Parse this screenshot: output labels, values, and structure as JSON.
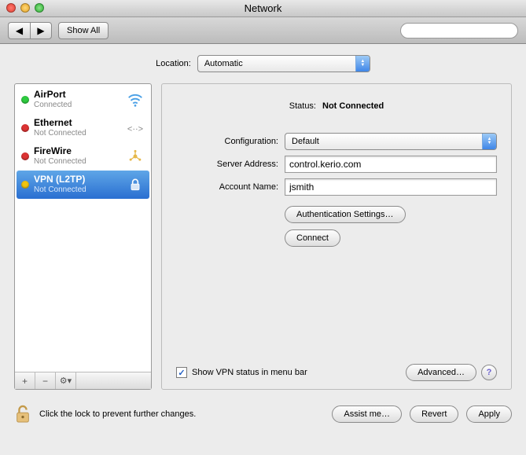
{
  "window": {
    "title": "Network"
  },
  "toolbar": {
    "show_all": "Show All",
    "search_placeholder": ""
  },
  "location": {
    "label": "Location:",
    "value": "Automatic"
  },
  "sidebar": {
    "items": [
      {
        "title": "AirPort",
        "subtitle": "Connected",
        "status": "green",
        "icon": "wifi-icon"
      },
      {
        "title": "Ethernet",
        "subtitle": "Not Connected",
        "status": "red",
        "icon": "ethernet-icon"
      },
      {
        "title": "FireWire",
        "subtitle": "Not Connected",
        "status": "red",
        "icon": "firewire-icon"
      },
      {
        "title": "VPN (L2TP)",
        "subtitle": "Not Connected",
        "status": "yellow",
        "icon": "vpn-lock-icon"
      }
    ],
    "selected_index": 3
  },
  "detail": {
    "status_label": "Status:",
    "status_value": "Not Connected",
    "config_label": "Configuration:",
    "config_value": "Default",
    "server_label": "Server Address:",
    "server_value": "control.kerio.com",
    "account_label": "Account Name:",
    "account_value": "jsmith",
    "auth_btn": "Authentication Settings…",
    "connect_btn": "Connect",
    "show_vpn_checkbox": "Show VPN status in menu bar",
    "show_vpn_checked": true,
    "advanced_btn": "Advanced…"
  },
  "footer": {
    "lock_text": "Click the lock to prevent further changes.",
    "assist": "Assist me…",
    "revert": "Revert",
    "apply": "Apply"
  }
}
